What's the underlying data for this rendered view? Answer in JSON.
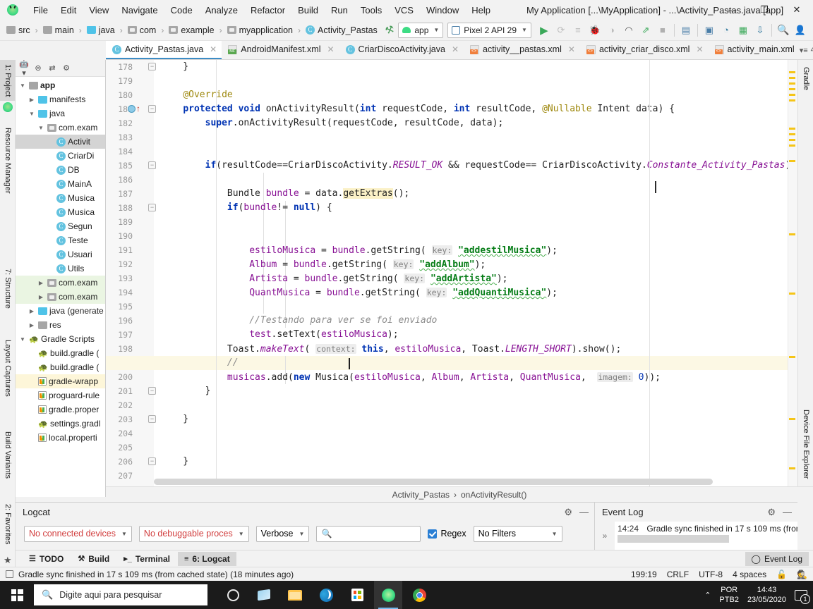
{
  "window": {
    "title": "My Application [...\\MyApplication] - ...\\Activity_Pastas.java [app]",
    "minimize": "—",
    "maximize": "❐",
    "close": "✕"
  },
  "menubar": {
    "items": [
      "File",
      "Edit",
      "View",
      "Navigate",
      "Code",
      "Analyze",
      "Refactor",
      "Build",
      "Run",
      "Tools",
      "VCS",
      "Window",
      "Help"
    ]
  },
  "navbar": {
    "breadcrumbs": [
      {
        "label": "src",
        "icon": "folder-icon"
      },
      {
        "label": "main",
        "icon": "folder-icon"
      },
      {
        "label": "java",
        "icon": "folder-blue-icon"
      },
      {
        "label": "com",
        "icon": "package-icon"
      },
      {
        "label": "example",
        "icon": "package-icon"
      },
      {
        "label": "myapplication",
        "icon": "package-icon"
      },
      {
        "label": "Activity_Pastas",
        "icon": "class-icon"
      }
    ],
    "module_selector": "app",
    "device_selector": "Pixel 2 API 29",
    "icons": [
      "make-project-icon",
      "run-icon",
      "apply-changes-icon",
      "apply-code-changes-icon",
      "debug-icon",
      "debug-attach-icon",
      "profiler-icon",
      "attach-debugger-icon",
      "stop-icon",
      "sdk-manager-icon",
      "avd-manager-icon",
      "layout-inspector-icon",
      "device-file-explorer-icon",
      "sync-gradle-icon",
      "search-everywhere-icon",
      "account-icon"
    ]
  },
  "tabs": [
    {
      "label": "Activity_Pastas.java",
      "icon": "java-class-icon",
      "active": true,
      "closeable": true
    },
    {
      "label": "AndroidManifest.xml",
      "icon": "manifest-icon",
      "active": false,
      "closeable": true
    },
    {
      "label": "CriarDiscoActivity.java",
      "icon": "java-class-icon",
      "active": false,
      "closeable": true
    },
    {
      "label": "activity__pastas.xml",
      "icon": "xml-layout-icon",
      "active": false,
      "closeable": true
    },
    {
      "label": "activity_criar_disco.xml",
      "icon": "xml-layout-icon",
      "active": false,
      "closeable": true
    },
    {
      "label": "activity_main.xml",
      "icon": "xml-layout-icon",
      "active": false,
      "closeable": false
    }
  ],
  "tabs_overflow": "4",
  "left_strip": [
    {
      "label": "1: Project",
      "selected": true
    },
    {
      "label": "Resource Manager",
      "selected": false
    },
    {
      "label": "7: Structure",
      "selected": false
    },
    {
      "label": "Layout Captures",
      "selected": false
    },
    {
      "label": "Build Variants",
      "selected": false
    },
    {
      "label": "2: Favorites",
      "selected": false
    }
  ],
  "right_strip": [
    {
      "label": "Gradle"
    },
    {
      "label": "Device File Explorer"
    }
  ],
  "project_tree": [
    {
      "indent": 0,
      "arrow": "▼",
      "icon": "module-icon",
      "label": "app",
      "bold": true,
      "state": "normal"
    },
    {
      "indent": 1,
      "arrow": "▶",
      "icon": "folder-blue-icon",
      "label": "manifests",
      "bold": false,
      "state": "normal"
    },
    {
      "indent": 1,
      "arrow": "▼",
      "icon": "folder-blue-icon",
      "label": "java",
      "bold": false,
      "state": "normal"
    },
    {
      "indent": 2,
      "arrow": "▼",
      "icon": "package-icon",
      "label": "com.exam",
      "bold": false,
      "state": "normal"
    },
    {
      "indent": 3,
      "arrow": "",
      "icon": "class-icon",
      "label": "Activit",
      "bold": false,
      "state": "selected"
    },
    {
      "indent": 3,
      "arrow": "",
      "icon": "class-icon",
      "label": "CriarDi",
      "bold": false,
      "state": "normal"
    },
    {
      "indent": 3,
      "arrow": "",
      "icon": "class-icon",
      "label": "DB",
      "bold": false,
      "state": "normal"
    },
    {
      "indent": 3,
      "arrow": "",
      "icon": "class-icon",
      "label": "MainA",
      "bold": false,
      "state": "normal"
    },
    {
      "indent": 3,
      "arrow": "",
      "icon": "class-icon",
      "label": "Musica",
      "bold": false,
      "state": "normal"
    },
    {
      "indent": 3,
      "arrow": "",
      "icon": "class-icon",
      "label": "Musica",
      "bold": false,
      "state": "normal"
    },
    {
      "indent": 3,
      "arrow": "",
      "icon": "class-icon",
      "label": "Segun",
      "bold": false,
      "state": "normal"
    },
    {
      "indent": 3,
      "arrow": "",
      "icon": "class-icon",
      "label": "Teste",
      "bold": false,
      "state": "normal"
    },
    {
      "indent": 3,
      "arrow": "",
      "icon": "class-icon",
      "label": "Usuari",
      "bold": false,
      "state": "normal"
    },
    {
      "indent": 3,
      "arrow": "",
      "icon": "class-icon",
      "label": "Utils",
      "bold": false,
      "state": "normal"
    },
    {
      "indent": 2,
      "arrow": "▶",
      "icon": "package-icon",
      "label": "com.exam",
      "bold": false,
      "state": "highlight-green"
    },
    {
      "indent": 2,
      "arrow": "▶",
      "icon": "package-icon",
      "label": "com.exam",
      "bold": false,
      "state": "highlight-green"
    },
    {
      "indent": 1,
      "arrow": "▶",
      "icon": "folder-generated-icon",
      "label": "java (generate",
      "bold": false,
      "state": "normal"
    },
    {
      "indent": 1,
      "arrow": "▶",
      "icon": "folder-res-icon",
      "label": "res",
      "bold": false,
      "state": "normal"
    },
    {
      "indent": 0,
      "arrow": "▼",
      "icon": "gradle-icon",
      "label": "Gradle Scripts",
      "bold": false,
      "state": "normal"
    },
    {
      "indent": 1,
      "arrow": "",
      "icon": "gradle-icon",
      "label": "build.gradle (",
      "bold": false,
      "state": "normal"
    },
    {
      "indent": 1,
      "arrow": "",
      "icon": "gradle-icon",
      "label": "build.gradle (",
      "bold": false,
      "state": "normal"
    },
    {
      "indent": 1,
      "arrow": "",
      "icon": "properties-icon",
      "label": "gradle-wrapp",
      "bold": false,
      "state": "highlight-yellow"
    },
    {
      "indent": 1,
      "arrow": "",
      "icon": "text-file-icon",
      "label": "proguard-rule",
      "bold": false,
      "state": "normal"
    },
    {
      "indent": 1,
      "arrow": "",
      "icon": "properties-icon",
      "label": "gradle.proper",
      "bold": false,
      "state": "normal"
    },
    {
      "indent": 1,
      "arrow": "",
      "icon": "gradle-icon",
      "label": "settings.gradl",
      "bold": false,
      "state": "normal"
    },
    {
      "indent": 1,
      "arrow": "",
      "icon": "properties-icon",
      "label": "local.properti",
      "bold": false,
      "state": "normal"
    }
  ],
  "editor": {
    "first_line": 178,
    "last_line": 207,
    "highlighted_line": 199,
    "lines": [
      {
        "n": 178,
        "text": "    }"
      },
      {
        "n": 179,
        "text": ""
      },
      {
        "n": 180,
        "text": "    @Override"
      },
      {
        "n": 181,
        "text": "    protected void onActivityResult(int requestCode, int resultCode, @Nullable Intent data) {"
      },
      {
        "n": 182,
        "text": "        super.onActivityResult(requestCode, resultCode, data);"
      },
      {
        "n": 183,
        "text": ""
      },
      {
        "n": 184,
        "text": ""
      },
      {
        "n": 185,
        "text": "        if(resultCode==CriarDiscoActivity.RESULT_OK && requestCode== CriarDiscoActivity.Constante_Activity_Pastas) {"
      },
      {
        "n": 186,
        "text": ""
      },
      {
        "n": 187,
        "text": "            Bundle bundle = data.getExtras();"
      },
      {
        "n": 188,
        "text": "            if(bundle!= null) {"
      },
      {
        "n": 189,
        "text": ""
      },
      {
        "n": 190,
        "text": ""
      },
      {
        "n": 191,
        "text": "                estiloMusica = bundle.getString( key: \"addestilMusica\");"
      },
      {
        "n": 192,
        "text": "                Album = bundle.getString( key: \"addAlbum\");"
      },
      {
        "n": 193,
        "text": "                Artista = bundle.getString( key: \"addArtista\");"
      },
      {
        "n": 194,
        "text": "                QuantMusica = bundle.getString( key: \"addQuantiMusica\");"
      },
      {
        "n": 195,
        "text": ""
      },
      {
        "n": 196,
        "text": "                //Testando para ver se foi enviado"
      },
      {
        "n": 197,
        "text": "                test.setText(estiloMusica);"
      },
      {
        "n": 198,
        "text": "            Toast.makeText( context: this, estiloMusica, Toast.LENGTH_SHORT).show();"
      },
      {
        "n": 199,
        "text": "            //"
      },
      {
        "n": 200,
        "text": "            musicas.add(new Musica(estiloMusica, Album, Artista, QuantMusica,  imagem: 0));"
      },
      {
        "n": 201,
        "text": "        }"
      },
      {
        "n": 202,
        "text": ""
      },
      {
        "n": 203,
        "text": "    }"
      },
      {
        "n": 204,
        "text": ""
      },
      {
        "n": 205,
        "text": ""
      },
      {
        "n": 206,
        "text": "    }"
      },
      {
        "n": 207,
        "text": ""
      }
    ],
    "breadcrumb": [
      "Activity_Pastas",
      "onActivityResult()"
    ],
    "breadcrumb_sep": "›"
  },
  "logcat": {
    "title": "Logcat",
    "device_filter": "No connected devices",
    "process_filter": "No debuggable proces",
    "level_filter": "Verbose",
    "search_placeholder": "Q▾",
    "regex_label": "Regex",
    "regex_checked": true,
    "filter_filter": "No Filters",
    "settings_icon": "gear-icon",
    "minimize_icon": "minimize-icon"
  },
  "event_log": {
    "title": "Event Log",
    "expand_icon": "»",
    "entries": [
      {
        "time": "14:24",
        "message": "Gradle sync finished in 17 s 109 ms (from"
      }
    ],
    "settings_icon": "gear-icon",
    "minimize_icon": "minimize-icon"
  },
  "bottom_tabs": [
    {
      "label": "TODO",
      "icon": "todo-icon",
      "selected": false
    },
    {
      "label": "Build",
      "icon": "build-icon",
      "selected": false
    },
    {
      "label": "Terminal",
      "icon": "terminal-icon",
      "selected": false
    },
    {
      "label": "6: Logcat",
      "icon": "logcat-icon",
      "selected": true
    }
  ],
  "bottom_right_tab": {
    "label": "Event Log",
    "icon": "event-log-icon"
  },
  "status_bar": {
    "message": "Gradle sync finished in 17 s 109 ms (from cached state) (18 minutes ago)",
    "caret_position": "199:19",
    "line_separator": "CRLF",
    "encoding": "UTF-8",
    "indent": "4 spaces",
    "lock_icon": "unlocked-icon",
    "inspection_icon": "hector-icon"
  },
  "taskbar": {
    "search_placeholder": "Digite aqui para pesquisar",
    "apps": [
      {
        "name": "cortana-icon"
      },
      {
        "name": "task-view-icon"
      },
      {
        "name": "file-explorer-icon"
      },
      {
        "name": "edge-icon"
      },
      {
        "name": "microsoft-store-icon"
      },
      {
        "name": "android-studio-icon",
        "active": true
      },
      {
        "name": "chrome-icon"
      }
    ],
    "tray": {
      "chevron": "⌃",
      "language_top": "POR",
      "language_bottom": "PTB2",
      "time": "14:43",
      "date": "23/05/2020",
      "notification_count": "1"
    }
  },
  "colors": {
    "accent": "#3c8cc5",
    "android_green": "#3ddc84",
    "keyword": "#0033b3",
    "string": "#067d17",
    "field": "#871094",
    "comment": "#8c8c8c",
    "annotation": "#9e880d",
    "error_red": "#d13d3d",
    "highlight_row": "#fcf8e4"
  }
}
